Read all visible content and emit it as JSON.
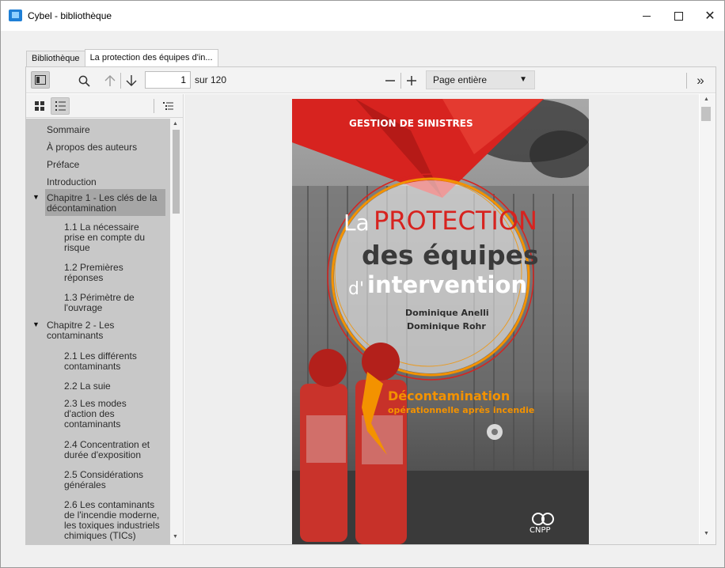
{
  "window": {
    "title": "Cybel - bibliothèque"
  },
  "tabs": [
    {
      "label": "Bibliothèque"
    },
    {
      "label": "La protection des équipes d'in..."
    }
  ],
  "toolbar": {
    "page_current": "1",
    "page_total": "sur 120",
    "zoom_mode": "Page entière",
    "icons": [
      "sidebar-toggle-icon",
      "search-icon",
      "arrow-up-icon",
      "arrow-down-icon",
      "zoom-out-icon",
      "zoom-in-icon",
      "chevron-double-right-icon"
    ]
  },
  "sidebar": {
    "toc": [
      {
        "label": "Sommaire"
      },
      {
        "label": "À propos des auteurs"
      },
      {
        "label": "Préface"
      },
      {
        "label": "Introduction"
      },
      {
        "label": "Chapitre 1 - Les clés de la décontamination",
        "expanded": true,
        "selected": true
      },
      {
        "label": "1.1 La nécessaire prise en compte du risque"
      },
      {
        "label": "1.2 Premières réponses"
      },
      {
        "label": "1.3 Périmètre de l'ouvrage"
      },
      {
        "label": "Chapitre 2 - Les contaminants",
        "expanded": true
      },
      {
        "label": "2.1 Les différents contaminants"
      },
      {
        "label": "2.2 La suie"
      },
      {
        "label": "2.3 Les modes d'action des contaminants"
      },
      {
        "label": "2.4 Concentration et durée d'exposition"
      },
      {
        "label": "2.5 Considérations générales"
      },
      {
        "label": "2.6 Les contaminants de l'incendie moderne, les toxiques industriels chimiques (TICs)"
      }
    ]
  },
  "cover": {
    "series": "GESTION DE SINISTRES",
    "title_la": "La",
    "title_protection": "PROTECTION",
    "title_line2": "des équipes",
    "title_d": "d'",
    "title_intervention": "intervention",
    "author1": "Dominique Anelli",
    "author2": "Dominique Rohr",
    "subtitle1": "Décontamination",
    "subtitle2": "opérationnelle après incendie",
    "publisher": "CNPP",
    "colors": {
      "red": "#d7231f",
      "orange": "#f39200",
      "photo": "#6f6f6f"
    }
  }
}
